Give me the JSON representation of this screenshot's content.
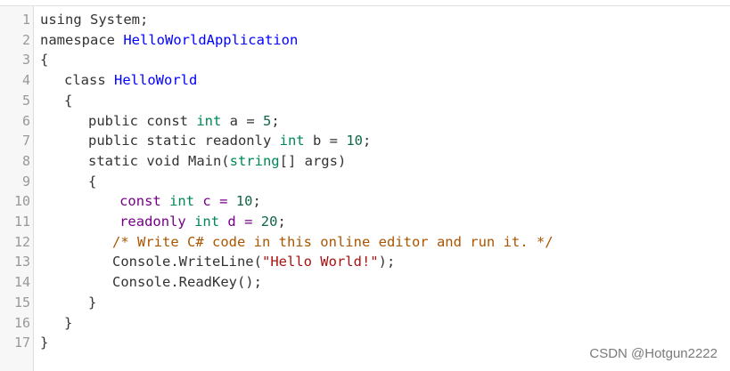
{
  "editor": {
    "lines": [
      {
        "n": "1",
        "tokens": [
          {
            "t": "using",
            "c": "pl"
          },
          {
            "t": " System;",
            "c": "pl"
          }
        ],
        "indent": 0
      },
      {
        "n": "2",
        "tokens": [
          {
            "t": "namespace ",
            "c": "pl"
          },
          {
            "t": "HelloWorldApplication",
            "c": "def"
          }
        ],
        "indent": 0
      },
      {
        "n": "3",
        "tokens": [
          {
            "t": "{",
            "c": "pl"
          }
        ],
        "indent": 0
      },
      {
        "n": "4",
        "tokens": [
          {
            "t": "class ",
            "c": "pl"
          },
          {
            "t": "HelloWorld",
            "c": "def"
          }
        ],
        "indent": 1
      },
      {
        "n": "5",
        "tokens": [
          {
            "t": "{",
            "c": "pl"
          }
        ],
        "indent": 1
      },
      {
        "n": "6",
        "tokens": [
          {
            "t": "public const ",
            "c": "pl"
          },
          {
            "t": "int",
            "c": "kw2"
          },
          {
            "t": " a = ",
            "c": "pl"
          },
          {
            "t": "5",
            "c": "num"
          },
          {
            "t": ";",
            "c": "pl"
          }
        ],
        "indent": 2
      },
      {
        "n": "7",
        "tokens": [
          {
            "t": "public static readonly ",
            "c": "pl"
          },
          {
            "t": "int",
            "c": "kw2"
          },
          {
            "t": " b = ",
            "c": "pl"
          },
          {
            "t": "10",
            "c": "num"
          },
          {
            "t": ";",
            "c": "pl"
          }
        ],
        "indent": 2
      },
      {
        "n": "8",
        "tokens": [
          {
            "t": "static void Main(",
            "c": "pl"
          },
          {
            "t": "string",
            "c": "kw2"
          },
          {
            "t": "[] args)",
            "c": "pl"
          }
        ],
        "indent": 2
      },
      {
        "n": "9",
        "tokens": [
          {
            "t": "{",
            "c": "pl"
          }
        ],
        "indent": 2
      },
      {
        "n": "10",
        "tokens": [
          {
            "t": "const ",
            "c": "kw"
          },
          {
            "t": "int",
            "c": "kw2"
          },
          {
            "t": " c = ",
            "c": "kw"
          },
          {
            "t": "10",
            "c": "num"
          },
          {
            "t": ";",
            "c": "pl"
          }
        ],
        "indent": 3.3
      },
      {
        "n": "11",
        "tokens": [
          {
            "t": "readonly ",
            "c": "kw"
          },
          {
            "t": "int",
            "c": "kw2"
          },
          {
            "t": " d = ",
            "c": "kw"
          },
          {
            "t": "20",
            "c": "num"
          },
          {
            "t": ";",
            "c": "pl"
          }
        ],
        "indent": 3.3
      },
      {
        "n": "12",
        "tokens": [
          {
            "t": "/* Write C# code in this online editor and run it. */",
            "c": "com"
          }
        ],
        "indent": 3
      },
      {
        "n": "13",
        "tokens": [
          {
            "t": "Console.WriteLine(",
            "c": "pl"
          },
          {
            "t": "\"Hello World!\"",
            "c": "str"
          },
          {
            "t": ");",
            "c": "pl"
          }
        ],
        "indent": 3
      },
      {
        "n": "14",
        "tokens": [
          {
            "t": "Console.ReadKey();",
            "c": "pl"
          }
        ],
        "indent": 3
      },
      {
        "n": "15",
        "tokens": [
          {
            "t": "}",
            "c": "pl"
          }
        ],
        "indent": 2
      },
      {
        "n": "16",
        "tokens": [
          {
            "t": "}",
            "c": "pl"
          }
        ],
        "indent": 1
      },
      {
        "n": "17",
        "tokens": [
          {
            "t": "}",
            "c": "pl"
          }
        ],
        "indent": 0
      }
    ]
  },
  "watermark": "CSDN @Hotgun2222"
}
